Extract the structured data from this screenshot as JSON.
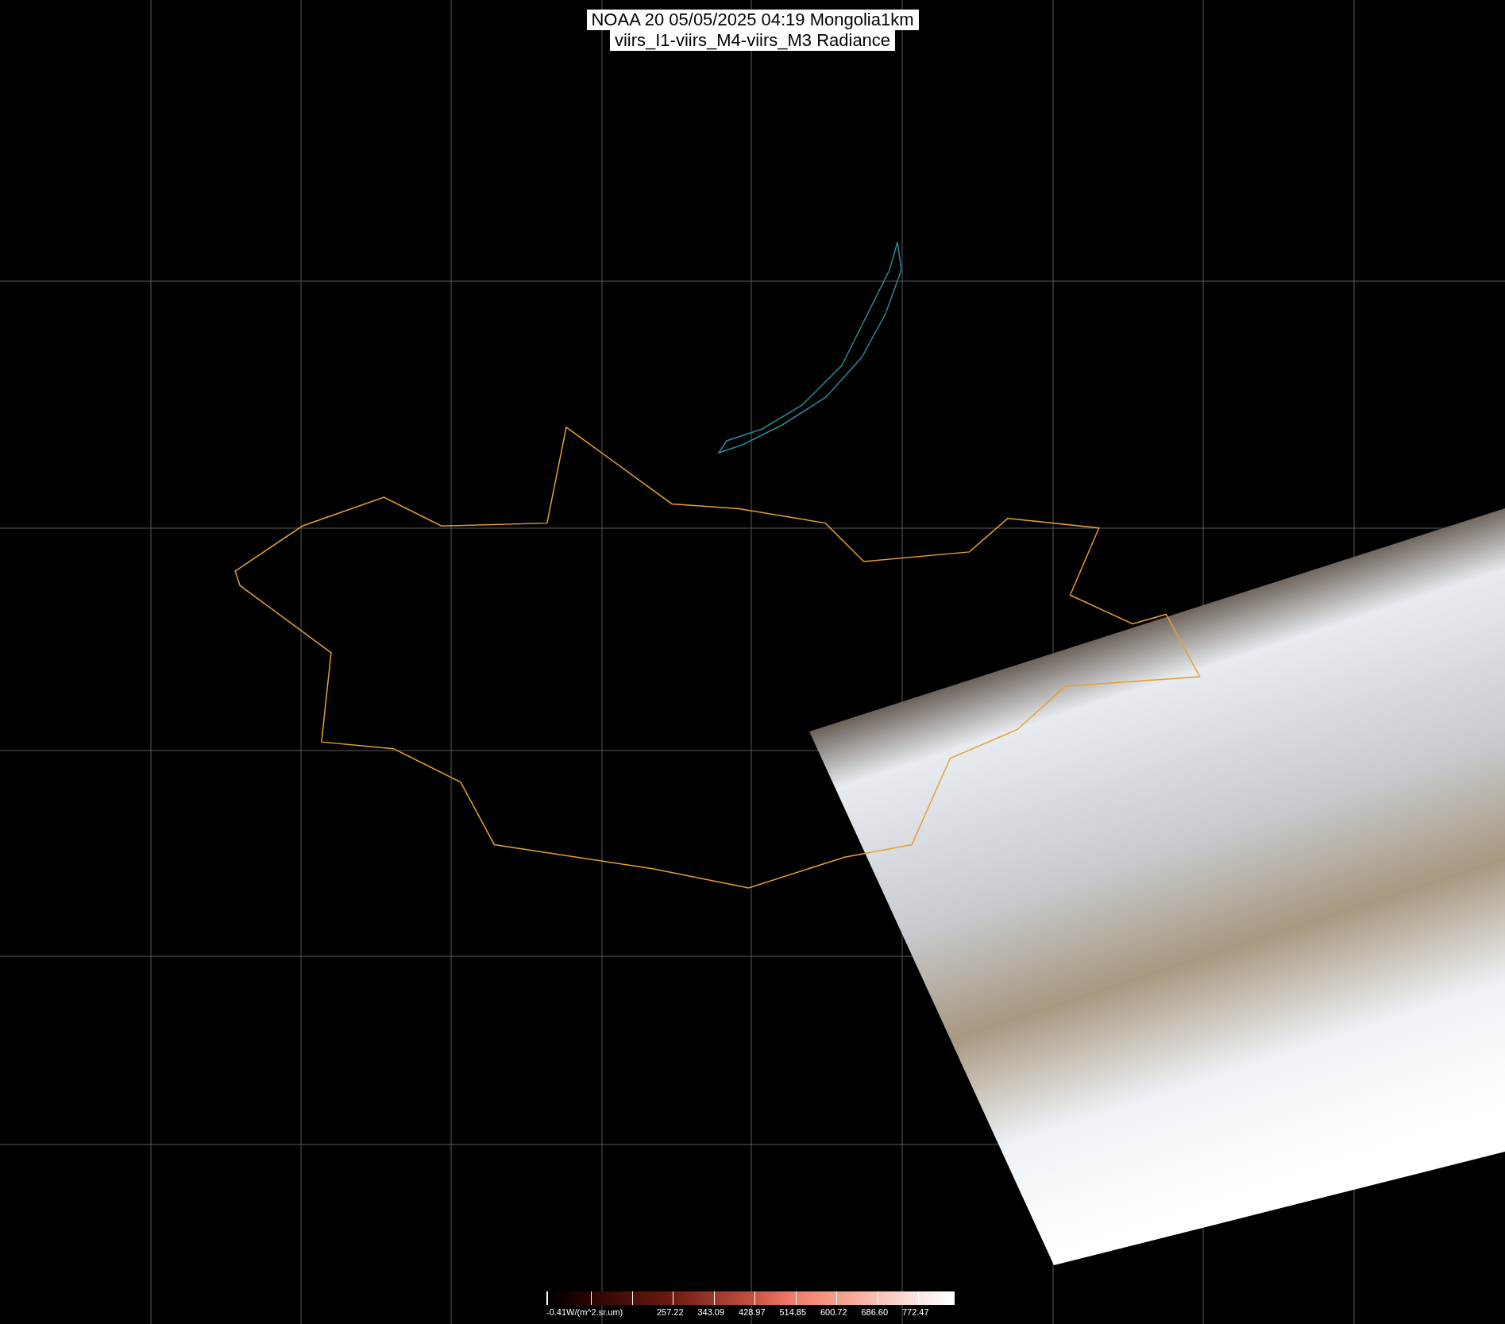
{
  "title": {
    "lines": [
      "NOAA 20 05/05/2025 04:19 Mongolia1km",
      "viirs_I1-viirs_M4-viirs_M3 Radiance"
    ]
  },
  "colorbar": {
    "unit_label": "-0.41W/(m^2.sr.um)",
    "tick_labels": [
      "257.22",
      "343.09",
      "428.97",
      "514.85",
      "600.72",
      "686.60",
      "772.47"
    ]
  }
}
